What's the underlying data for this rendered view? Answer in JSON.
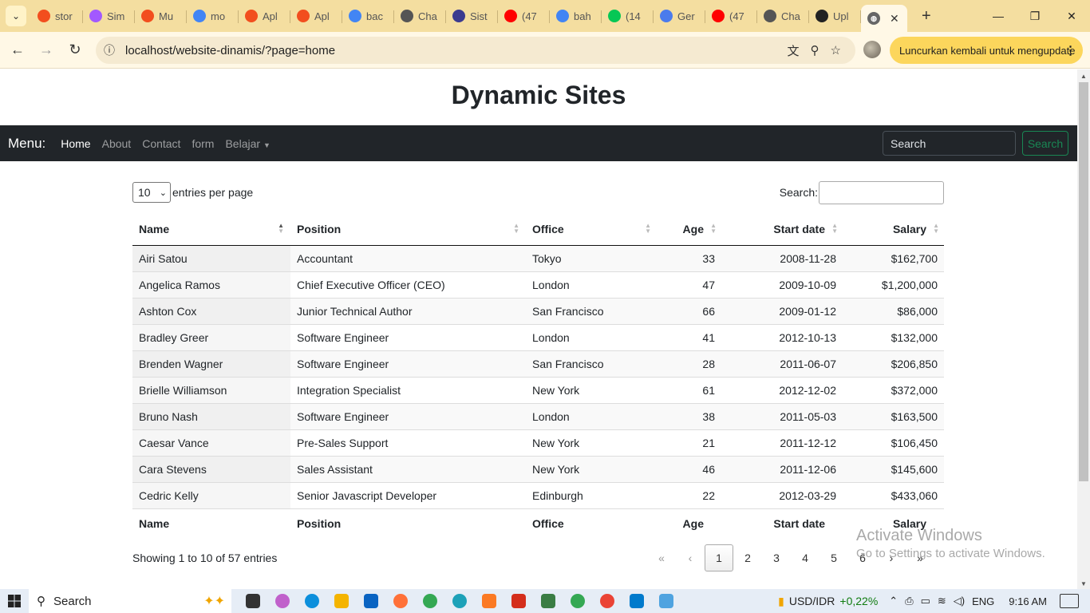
{
  "browser": {
    "tabs": [
      {
        "label": "stor",
        "icon": "figma-icon",
        "color": "#f24e1e"
      },
      {
        "label": "Sim",
        "icon": "figma-round-icon",
        "color": "#a259ff"
      },
      {
        "label": "Mu",
        "icon": "figma-icon",
        "color": "#f24e1e"
      },
      {
        "label": "mo",
        "icon": "google-icon",
        "color": "#4285f4"
      },
      {
        "label": "Apl",
        "icon": "figma-icon",
        "color": "#f24e1e"
      },
      {
        "label": "Apl",
        "icon": "figma-icon",
        "color": "#f24e1e"
      },
      {
        "label": "bac",
        "icon": "google-icon",
        "color": "#4285f4"
      },
      {
        "label": "Cha",
        "icon": "openai-icon",
        "color": "#555555"
      },
      {
        "label": "Sist",
        "icon": "university-icon",
        "color": "#3b3b8f"
      },
      {
        "label": "(47",
        "icon": "youtube-icon",
        "color": "#ff0000"
      },
      {
        "label": "bah",
        "icon": "google-icon",
        "color": "#4285f4"
      },
      {
        "label": "(14",
        "icon": "line-icon",
        "color": "#06c755"
      },
      {
        "label": "Ger",
        "icon": "gemini-icon",
        "color": "#4b7bec"
      },
      {
        "label": "(47",
        "icon": "youtube-icon",
        "color": "#ff0000"
      },
      {
        "label": "Cha",
        "icon": "openai-icon",
        "color": "#555555"
      },
      {
        "label": "Upl",
        "icon": "github-icon",
        "color": "#222222"
      }
    ],
    "active_tab_icon": "globe-icon",
    "url": "localhost/website-dinamis/?page=home",
    "relaunch_label": "Luncurkan kembali untuk mengupdate"
  },
  "site": {
    "title": "Dynamic Sites",
    "brand": "Menu:",
    "nav": [
      {
        "label": "Home",
        "active": true
      },
      {
        "label": "About"
      },
      {
        "label": "Contact"
      },
      {
        "label": "form"
      },
      {
        "label": "Belajar",
        "dropdown": true
      }
    ],
    "search_placeholder": "Search",
    "search_button": "Search"
  },
  "datatable": {
    "page_length": "10",
    "entries_label": "entries per page",
    "search_label": "Search:",
    "columns": [
      "Name",
      "Position",
      "Office",
      "Age",
      "Start date",
      "Salary"
    ],
    "rows": [
      [
        "Airi Satou",
        "Accountant",
        "Tokyo",
        "33",
        "2008-11-28",
        "$162,700"
      ],
      [
        "Angelica Ramos",
        "Chief Executive Officer (CEO)",
        "London",
        "47",
        "2009-10-09",
        "$1,200,000"
      ],
      [
        "Ashton Cox",
        "Junior Technical Author",
        "San Francisco",
        "66",
        "2009-01-12",
        "$86,000"
      ],
      [
        "Bradley Greer",
        "Software Engineer",
        "London",
        "41",
        "2012-10-13",
        "$132,000"
      ],
      [
        "Brenden Wagner",
        "Software Engineer",
        "San Francisco",
        "28",
        "2011-06-07",
        "$206,850"
      ],
      [
        "Brielle Williamson",
        "Integration Specialist",
        "New York",
        "61",
        "2012-12-02",
        "$372,000"
      ],
      [
        "Bruno Nash",
        "Software Engineer",
        "London",
        "38",
        "2011-05-03",
        "$163,500"
      ],
      [
        "Caesar Vance",
        "Pre-Sales Support",
        "New York",
        "21",
        "2011-12-12",
        "$106,450"
      ],
      [
        "Cara Stevens",
        "Sales Assistant",
        "New York",
        "46",
        "2011-12-06",
        "$145,600"
      ],
      [
        "Cedric Kelly",
        "Senior Javascript Developer",
        "Edinburgh",
        "22",
        "2012-03-29",
        "$433,060"
      ]
    ],
    "info": "Showing 1 to 10 of 57 entries",
    "pagination": [
      "«",
      "‹",
      "1",
      "2",
      "3",
      "4",
      "5",
      "6",
      "›",
      "»"
    ],
    "current_page": "1"
  },
  "watermark": {
    "line1": "Activate Windows",
    "line2": "Go to Settings to activate Windows."
  },
  "taskbar": {
    "search_label": "Search",
    "apps": [
      {
        "name": "task-view-icon",
        "color": "#333333"
      },
      {
        "name": "copilot-icon",
        "color": "#c061cb"
      },
      {
        "name": "edge-icon",
        "color": "#0c8fdc"
      },
      {
        "name": "file-explorer-icon",
        "color": "#f4b400"
      },
      {
        "name": "mail-icon",
        "color": "#0a64c2"
      },
      {
        "name": "firefox-icon",
        "color": "#ff7139"
      },
      {
        "name": "chrome-icon",
        "color": "#34a853"
      },
      {
        "name": "chrome-canary-icon",
        "color": "#1da1b8"
      },
      {
        "name": "xampp-icon",
        "color": "#fb7a24"
      },
      {
        "name": "wps-icon",
        "color": "#d42e1c"
      },
      {
        "name": "app-icon",
        "color": "#3a7d44"
      },
      {
        "name": "chrome-profile-icon",
        "color": "#34a853"
      },
      {
        "name": "chrome-profile2-icon",
        "color": "#ea4335"
      },
      {
        "name": "vscode-icon",
        "color": "#007acc"
      },
      {
        "name": "notepad-icon",
        "color": "#4fa3e0"
      }
    ],
    "stock_label": "USD/IDR",
    "stock_change": "+0,22%",
    "language": "ENG",
    "time": "9:16 AM"
  }
}
